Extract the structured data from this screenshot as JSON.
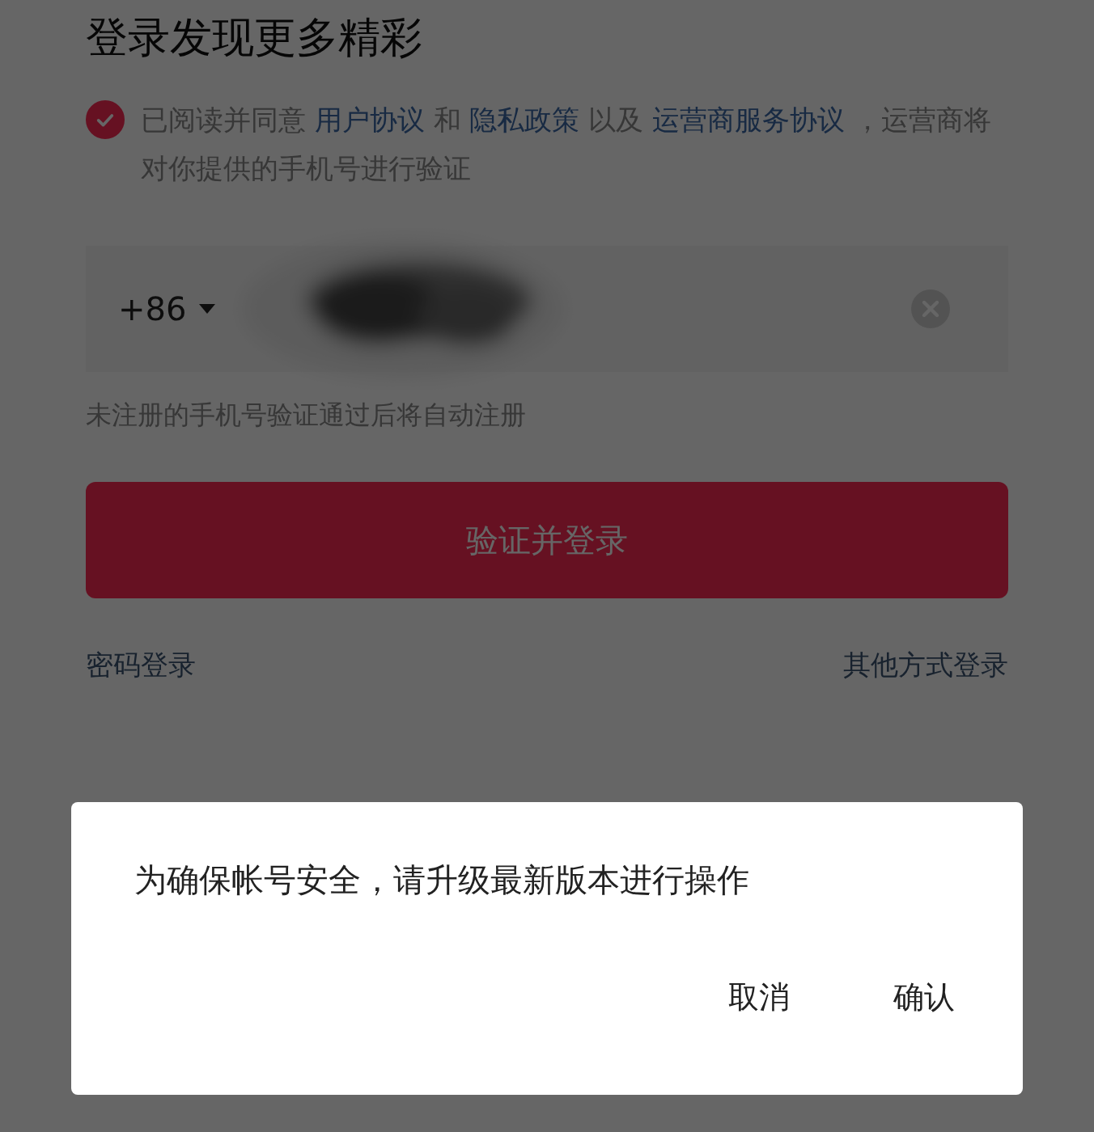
{
  "title": "登录发现更多精彩",
  "agreement": {
    "checked": true,
    "parts": [
      {
        "kind": "text",
        "text": "已阅读并同意 "
      },
      {
        "kind": "link",
        "text": "用户协议"
      },
      {
        "kind": "text",
        "text": " 和 "
      },
      {
        "kind": "link",
        "text": "隐私政策"
      },
      {
        "kind": "text",
        "text": " 以及 "
      },
      {
        "kind": "link",
        "text": "运营商服务协议"
      },
      {
        "kind": "text",
        "text": " ，运营商将对你提供的手机号进行验证"
      }
    ]
  },
  "phone_field": {
    "country_code": "+86",
    "redacted": true
  },
  "hint": "未注册的手机号验证通过后将自动注册",
  "submit_button": "验证并登录",
  "links": {
    "left": "密码登录",
    "right": "其他方式登录"
  },
  "dialog": {
    "message": "为确保帐号安全，请升级最新版本进行操作",
    "buttons": [
      "取消",
      "确认"
    ]
  }
}
